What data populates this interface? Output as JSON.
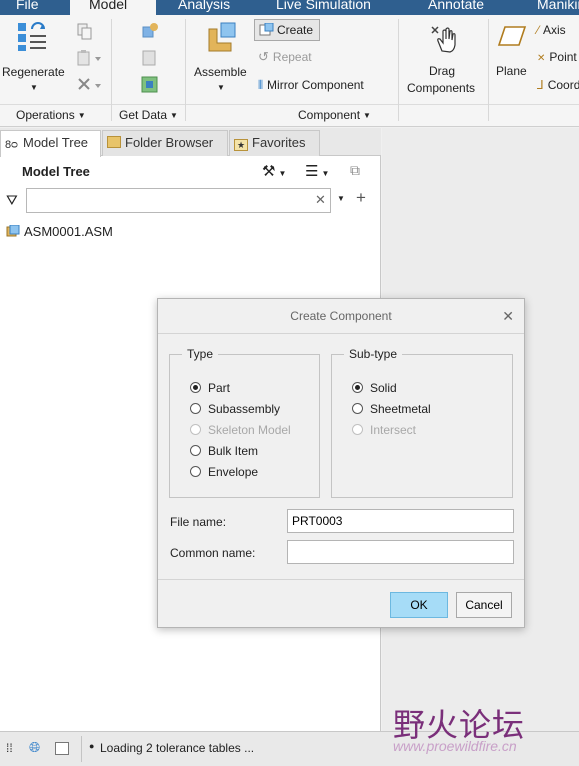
{
  "menu_tabs": [
    "File",
    "Model",
    "Analysis",
    "Live Simulation",
    "Annotate",
    "Manikin"
  ],
  "active_menu_tab": "Model",
  "ribbon": {
    "regenerate": "Regenerate",
    "operations": "Operations",
    "get_data": "Get Data",
    "assemble": "Assemble",
    "create": "Create",
    "repeat": "Repeat",
    "mirror_component": "Mirror Component",
    "component": "Component",
    "drag_components_line1": "Drag",
    "drag_components_line2": "Components",
    "plane": "Plane",
    "axis": "Axis",
    "point": "Point",
    "coordinate": "Coordinate"
  },
  "left_pane": {
    "tabs": [
      "Model Tree",
      "Folder Browser",
      "Favorites"
    ],
    "tree_header": "Model Tree",
    "filter_value": "",
    "tree_items": [
      "ASM0001.ASM"
    ]
  },
  "status_bar": {
    "message": "Loading 2 tolerance tables ..."
  },
  "watermark": {
    "text": "野火论坛",
    "url": "www.proewildfire.cn"
  },
  "dialog": {
    "title": "Create Component",
    "type_legend": "Type",
    "type_options": [
      {
        "label": "Part",
        "selected": true,
        "enabled": true
      },
      {
        "label": "Subassembly",
        "selected": false,
        "enabled": true
      },
      {
        "label": "Skeleton Model",
        "selected": false,
        "enabled": false
      },
      {
        "label": "Bulk Item",
        "selected": false,
        "enabled": true
      },
      {
        "label": "Envelope",
        "selected": false,
        "enabled": true
      }
    ],
    "subtype_legend": "Sub-type",
    "subtype_options": [
      {
        "label": "Solid",
        "selected": true,
        "enabled": true
      },
      {
        "label": "Sheetmetal",
        "selected": false,
        "enabled": true
      },
      {
        "label": "Intersect",
        "selected": false,
        "enabled": false
      }
    ],
    "file_name_label": "File name:",
    "file_name_value": "PRT0003",
    "common_name_label": "Common name:",
    "common_name_value": "",
    "ok": "OK",
    "cancel": "Cancel"
  },
  "colors": {
    "menubar": "#2f5f8f",
    "ok_button": "#a6dcf7",
    "watermark": "#7a2f7a"
  }
}
